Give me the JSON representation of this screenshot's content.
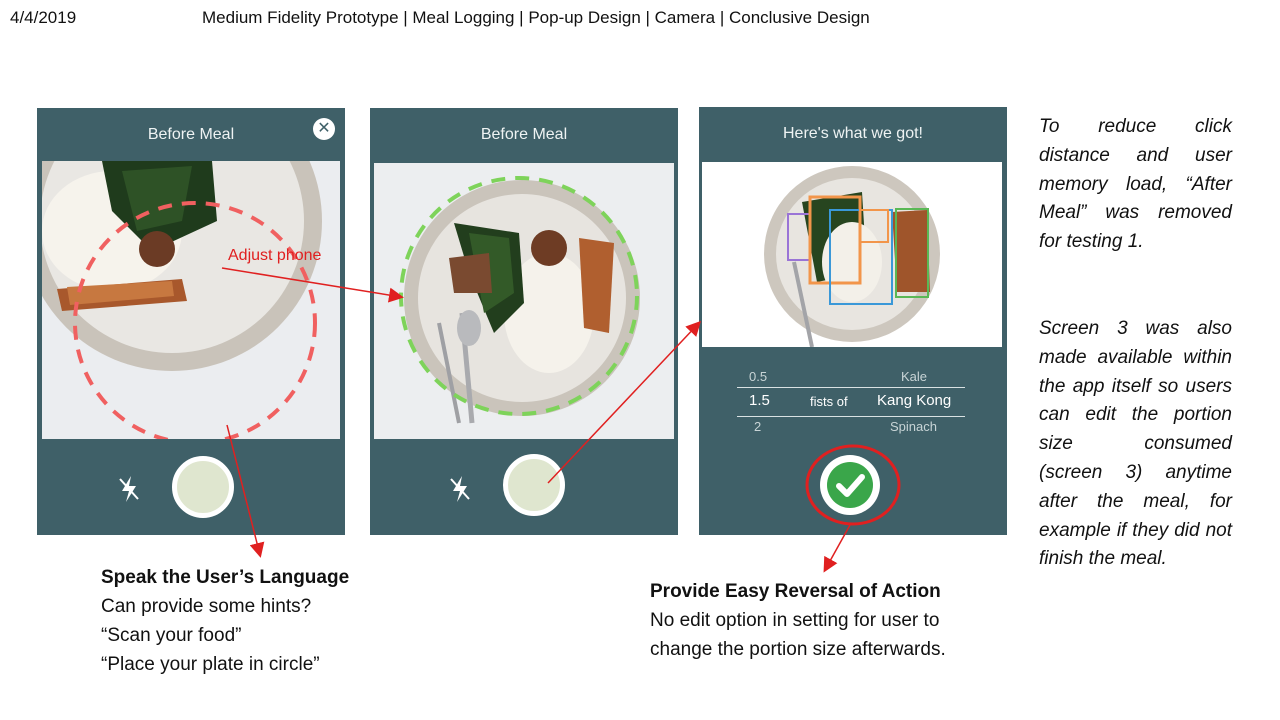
{
  "header": {
    "date": "4/4/2019",
    "title": "Medium Fidelity Prototype | Meal Logging | Pop-up Design | Camera | Conclusive Design"
  },
  "screens": [
    {
      "title": "Before Meal",
      "close_icon": "close-icon",
      "flash_icon": "flash-off-icon",
      "guide_circle_color": "#f06060"
    },
    {
      "title": "Before Meal",
      "flash_icon": "flash-off-icon",
      "guide_circle_color": "#7ed35a"
    },
    {
      "title": "Here's what we got!",
      "portion_picker": {
        "unit": "fists of",
        "rows": [
          {
            "amount": "0.5",
            "food": "Kale"
          },
          {
            "amount": "1.5",
            "food": "Kang Kong"
          },
          {
            "amount": "2",
            "food": "Spinach"
          }
        ],
        "selected_index": 1
      },
      "confirm_icon": "checkmark-icon"
    }
  ],
  "annotation": {
    "adjust_label": "Adjust phone",
    "color": "#e02020"
  },
  "notes": {
    "left": {
      "heading": "Speak the User’s Language",
      "lines": [
        "Can provide some hints?",
        "“Scan your food”",
        "“Place your plate in circle”"
      ]
    },
    "right": {
      "heading": "Provide Easy Reversal of Action",
      "lines": [
        "No edit option in setting for user to",
        "change the portion size afterwards."
      ]
    }
  },
  "side_text": {
    "para1": "To reduce click distance and user memory load, “After Meal” was removed for testing 1.",
    "para2": "Screen 3 was also made available within the app itself so users can edit the portion size consumed (screen 3) anytime after the meal, for example if they did not finish the meal."
  },
  "colors": {
    "phone_bg": "#3f6068",
    "accent_red": "#e02020",
    "green_guide": "#7ed35a",
    "check_green": "#3aa64a"
  }
}
